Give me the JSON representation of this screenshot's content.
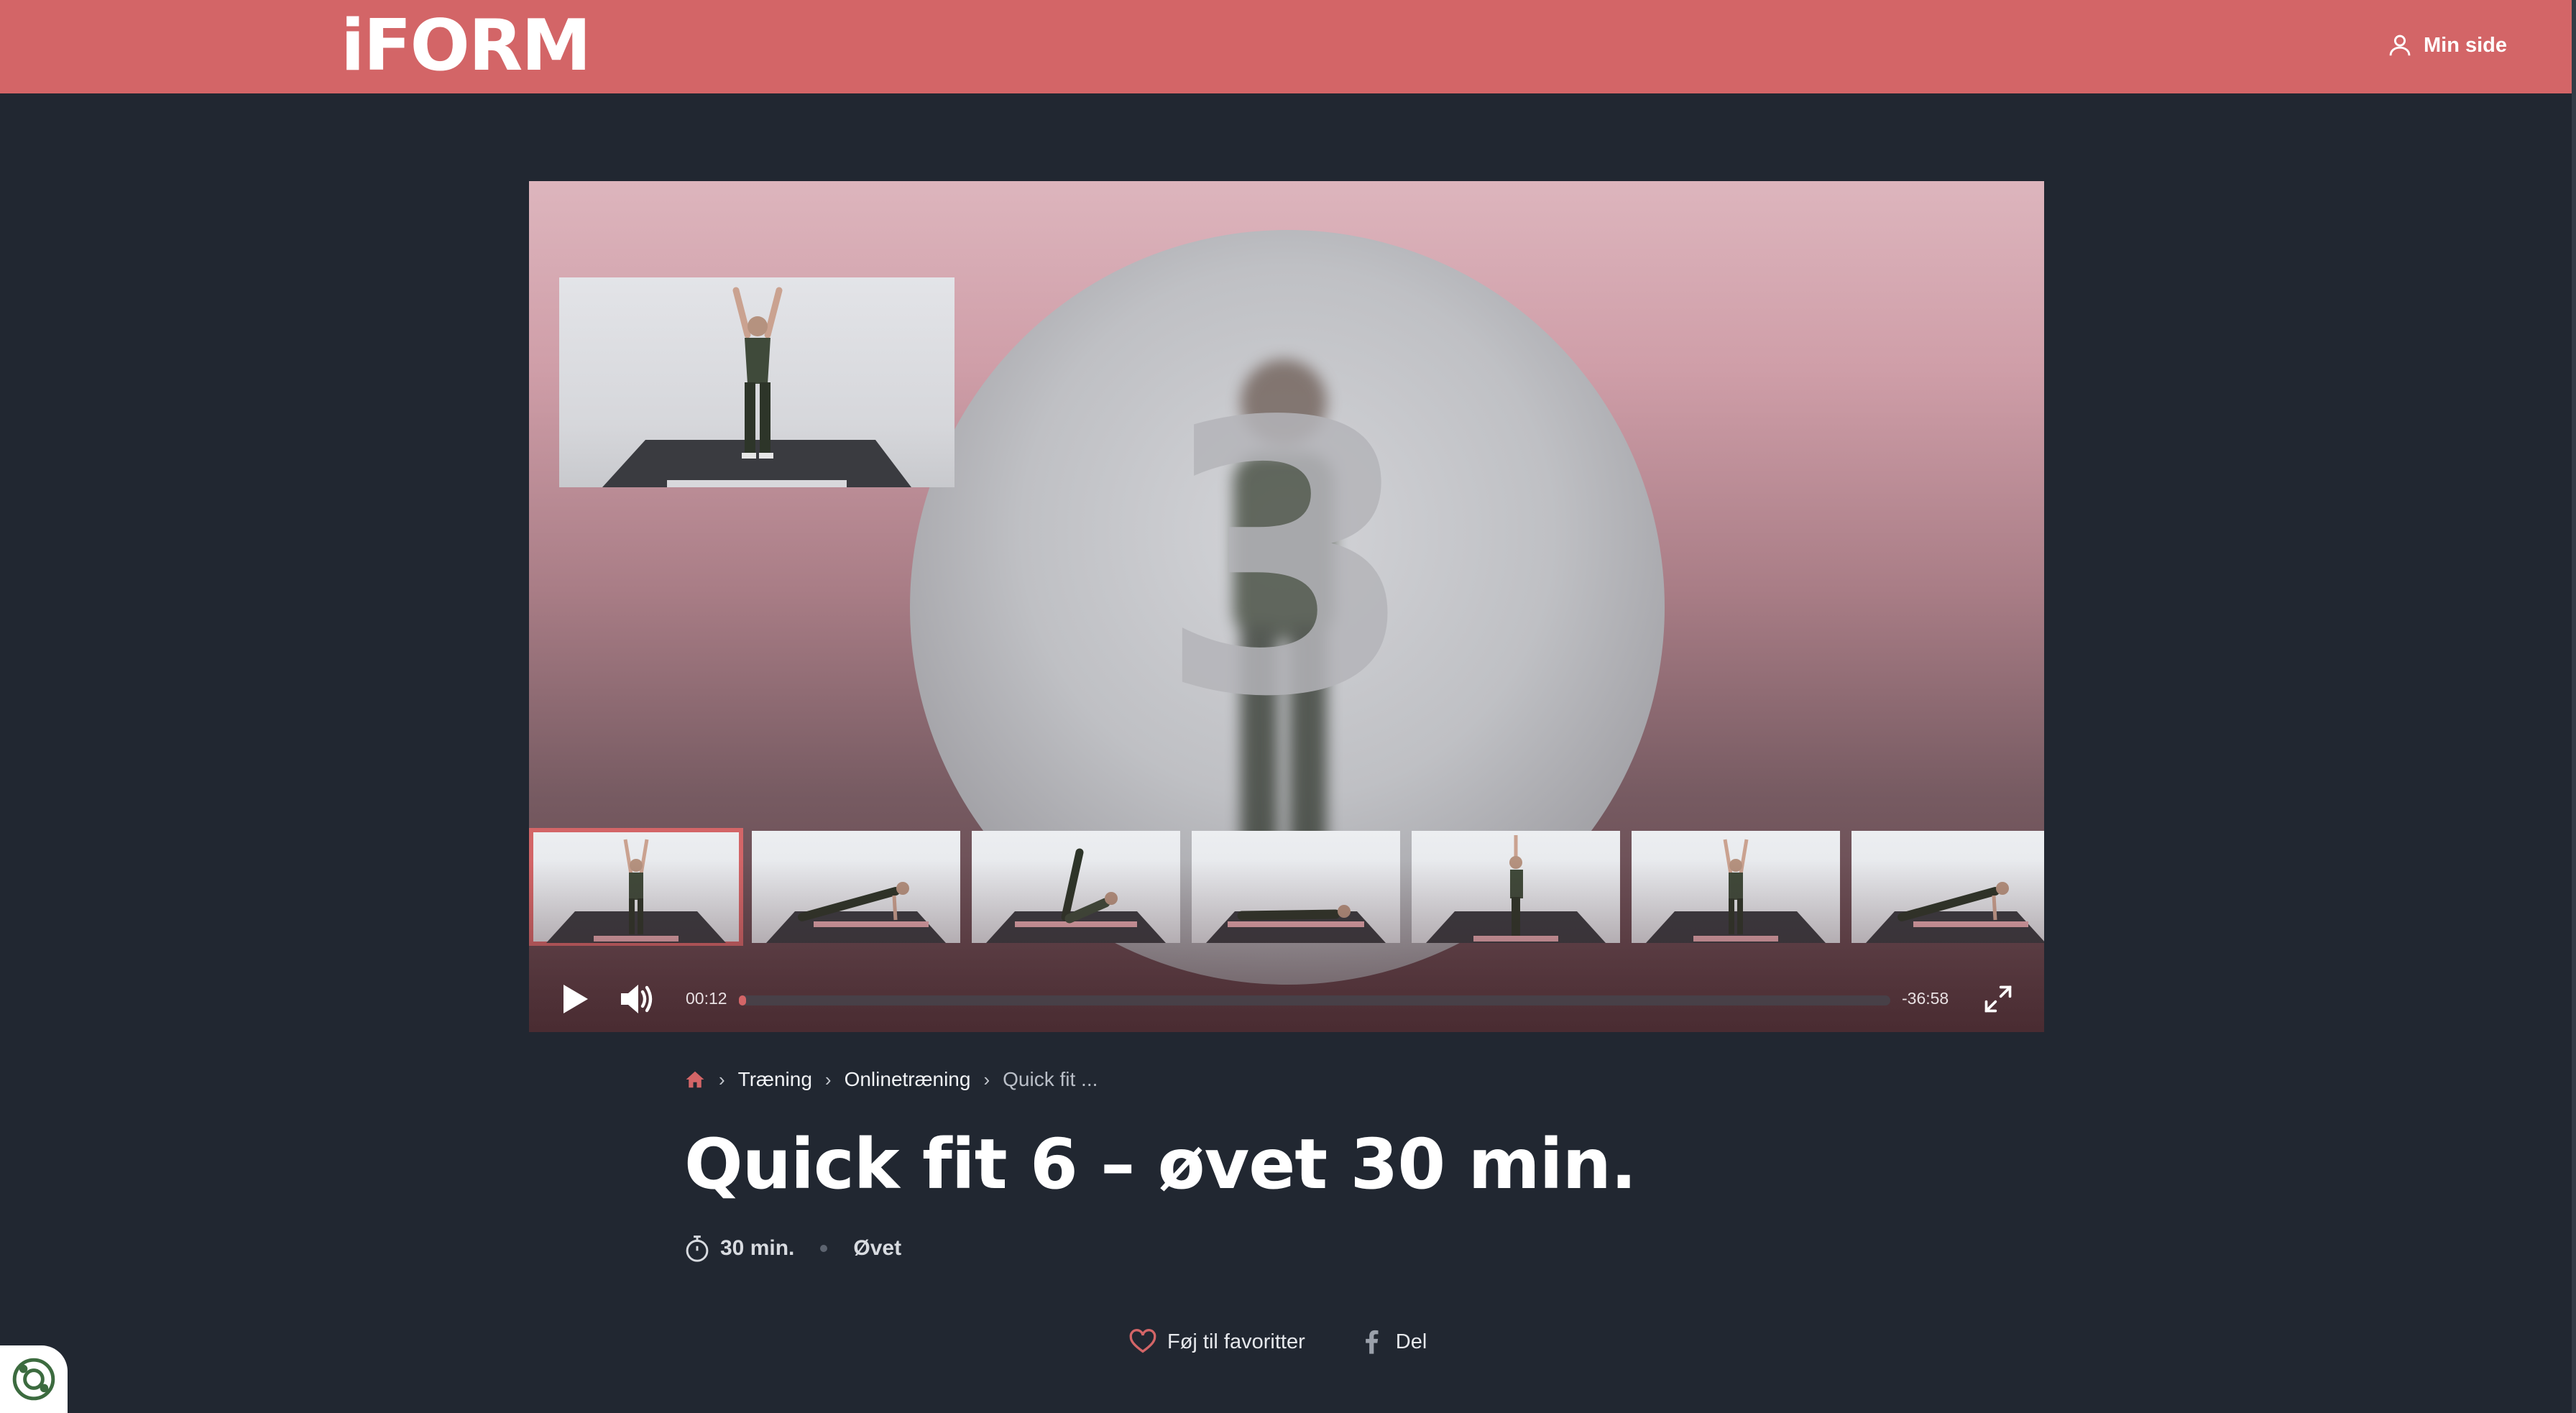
{
  "header": {
    "logo_text": "iFORM",
    "account_label": "Min side",
    "background_color": "#d36567"
  },
  "player": {
    "countdown_number": "3",
    "current_time": "00:12",
    "remaining_time": "-36:58",
    "progress_fraction": 0.005,
    "accent_color": "#d36567",
    "thumbnails": [
      {
        "pose": "arms-raised",
        "active": true
      },
      {
        "pose": "plank",
        "active": false
      },
      {
        "pose": "crunch",
        "active": false
      },
      {
        "pose": "lying",
        "active": false
      },
      {
        "pose": "standing-reach",
        "active": false
      },
      {
        "pose": "arms-raised",
        "active": false
      },
      {
        "pose": "plank",
        "active": false
      }
    ],
    "icons": {
      "play": "play-icon",
      "volume": "volume-icon",
      "fullscreen": "fullscreen-icon"
    }
  },
  "breadcrumb": {
    "home_icon": "home-icon",
    "items": [
      "Træning",
      "Onlinetræning",
      "Quick fit ..."
    ]
  },
  "workout": {
    "title": "Quick fit 6 – øvet 30 min.",
    "duration": "30 min.",
    "level": "Øvet"
  },
  "actions": {
    "favorite_label": "Føj til favoritter",
    "share_label": "Del"
  }
}
